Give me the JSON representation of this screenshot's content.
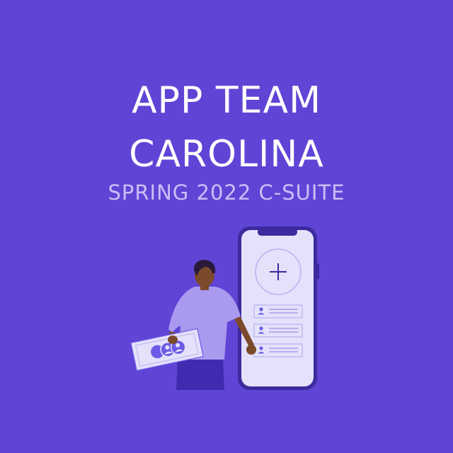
{
  "poster": {
    "title_line_1": "APP TEAM",
    "title_line_2": "CAROLINA",
    "subtitle": "SPRING 2022 C-SUITE"
  },
  "colors": {
    "background": "#6044d6",
    "title": "#ffffff",
    "subtitle": "#c9bff7",
    "phone_frame": "#3c2a9e",
    "phone_screen": "#e4e1fb",
    "accent": "#6c5ce7"
  },
  "icons": {
    "add": "plus-icon",
    "contact": "person-icon",
    "money": "banknote-icon"
  }
}
